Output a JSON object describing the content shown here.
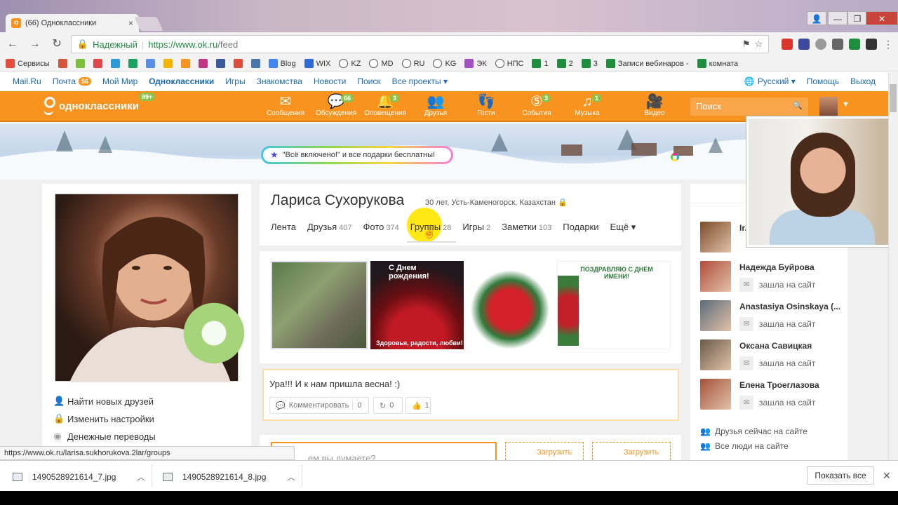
{
  "browser": {
    "tab_title": "(66) Одноклассники",
    "tab_close": "×",
    "url_secure_label": "Надежный",
    "url_sep": "|",
    "url_scheme_host": "https://www.ok.ru",
    "url_path": "/feed",
    "nav": {
      "back": "←",
      "forward": "→",
      "reload": "↻"
    },
    "window_controls": {
      "user": "👤",
      "min": "—",
      "max": "❐",
      "close": "✕"
    },
    "bookmarks": [
      {
        "label": "Сервисы",
        "color": "#e44c3c"
      },
      {
        "label": "",
        "color": "#d4553a"
      },
      {
        "label": "",
        "color": "#7bbf3a"
      },
      {
        "label": "",
        "color": "#e0464a"
      },
      {
        "label": "",
        "color": "#2c9ad6"
      },
      {
        "label": "",
        "color": "#1aa260"
      },
      {
        "label": "",
        "color": "#5a8ee6"
      },
      {
        "label": "",
        "color": "#f4b400"
      },
      {
        "label": "",
        "color": "#f7931e"
      },
      {
        "label": "",
        "color": "#c13584"
      },
      {
        "label": "",
        "color": "#3b5998"
      },
      {
        "label": "",
        "color": "#dd4b39"
      },
      {
        "label": "",
        "color": "#4a76a8"
      },
      {
        "label": "Blog",
        "color": "#4285f4"
      },
      {
        "label": "WIX",
        "color": "#2c6ad6"
      },
      {
        "label": "KZ",
        "color": "#fff"
      },
      {
        "label": "MD",
        "color": "#fff"
      },
      {
        "label": "RU",
        "color": "#fff"
      },
      {
        "label": "KG",
        "color": "#fff"
      },
      {
        "label": "ЭК",
        "color": "#a050c0"
      },
      {
        "label": "НПС",
        "color": "#fff"
      },
      {
        "label": "1",
        "color": "#1e8e3e"
      },
      {
        "label": "2",
        "color": "#1e8e3e"
      },
      {
        "label": "3",
        "color": "#1e8e3e"
      },
      {
        "label": "Записи вебинаров -",
        "color": "#1e8e3e"
      },
      {
        "label": "комната",
        "color": "#1e8e3e"
      }
    ],
    "bookmarks_more": "»"
  },
  "ok": {
    "top_nav": {
      "mailru": "Mail.Ru",
      "pochta": "Почта",
      "pochta_count": "56",
      "moi_mir": "Мой Мир",
      "odnoklassniki": "Одноклассники",
      "igry": "Игры",
      "znakomstva": "Знакомства",
      "novosti": "Новости",
      "poisk": "Поиск",
      "vse_proekty": "Все проекты ▾",
      "lang": "Русский ▾",
      "help": "Помощь",
      "exit": "Выход"
    },
    "logo_text": "одноклассники",
    "logo_badge": "99+",
    "nav_items": [
      {
        "label": "Сообщения",
        "icon": "✉",
        "badge": ""
      },
      {
        "label": "Обсуждения",
        "icon": "💬",
        "badge": "66"
      },
      {
        "label": "Оповещения",
        "icon": "🔔",
        "badge": "3"
      },
      {
        "label": "Друзья",
        "icon": "👥",
        "badge": ""
      },
      {
        "label": "Гости",
        "icon": "👣",
        "badge": ""
      },
      {
        "label": "События",
        "icon": "⑤",
        "badge": "3"
      },
      {
        "label": "Музыка",
        "icon": "♫",
        "badge": "1"
      },
      {
        "label": "Видео",
        "icon": "🎥",
        "badge": ""
      }
    ],
    "search_placeholder": "Поиск",
    "search_icon": "🔍",
    "promo": "\"Всё включено!\" и все подарки бесплатны!",
    "promo_star": "★",
    "left_menu": [
      {
        "label": "Найти новых друзей",
        "icon": "👤"
      },
      {
        "label": "Изменить настройки",
        "icon": "🔒"
      },
      {
        "label": "Денежные переводы",
        "icon": "◉"
      }
    ],
    "profile": {
      "name": "Лариса Сухорукова",
      "meta": "30 лет, Усть-Каменогорск, Казахстан",
      "lock": "🔒",
      "tabs": [
        {
          "label": "Лента",
          "count": ""
        },
        {
          "label": "Друзья",
          "count": "407"
        },
        {
          "label": "Фото",
          "count": "374"
        },
        {
          "label": "Группы",
          "count": "28"
        },
        {
          "label": "Игры",
          "count": "2"
        },
        {
          "label": "Заметки",
          "count": "103"
        },
        {
          "label": "Подарки",
          "count": ""
        },
        {
          "label": "Ещё ▾",
          "count": ""
        }
      ],
      "photo2_title": "С Днем рождения!",
      "photo2_caption": "Здоровья, радости, любви!",
      "photo4_title": "ПОЗДРАВЛЯЮ С ДНЕМ ИМЕНИ!"
    },
    "post": {
      "text": "Ура!!! И к нам пришла весна! :)",
      "comment_label": "Комментировать",
      "comment_count": "0",
      "share_count": "0",
      "like_count": "1"
    },
    "compose": {
      "placeholder": "...ем вы думаете?",
      "upload1": "Загрузить",
      "upload2": "Загрузить"
    },
    "friends_online": [
      {
        "name": "Ir...",
        "status": "",
        "color": "#7a4b2a"
      },
      {
        "name": "Надежда Буйрова",
        "status": "зашла на сайт",
        "color": "#b04a3a"
      },
      {
        "name": "Anastasiya Osinskaya (...",
        "status": "зашла на сайт",
        "color": "#5a6a7a"
      },
      {
        "name": "Оксана Савицкая",
        "status": "зашла на сайт",
        "color": "#6a5a4a"
      },
      {
        "name": "Елена Троеглазова",
        "status": "зашла на сайт",
        "color": "#a4503a"
      }
    ],
    "friends_now_link": "Друзья сейчас на сайте",
    "all_people_link": "Все люди на сайте"
  },
  "status_url": "https://www.ok.ru/larisa.sukhorukova.2lar/groups",
  "downloads": [
    {
      "file": "1490528921614_7.jpg"
    },
    {
      "file": "1490528921614_8.jpg"
    }
  ],
  "downloads_show_all": "Показать все",
  "downloads_close": "✕"
}
